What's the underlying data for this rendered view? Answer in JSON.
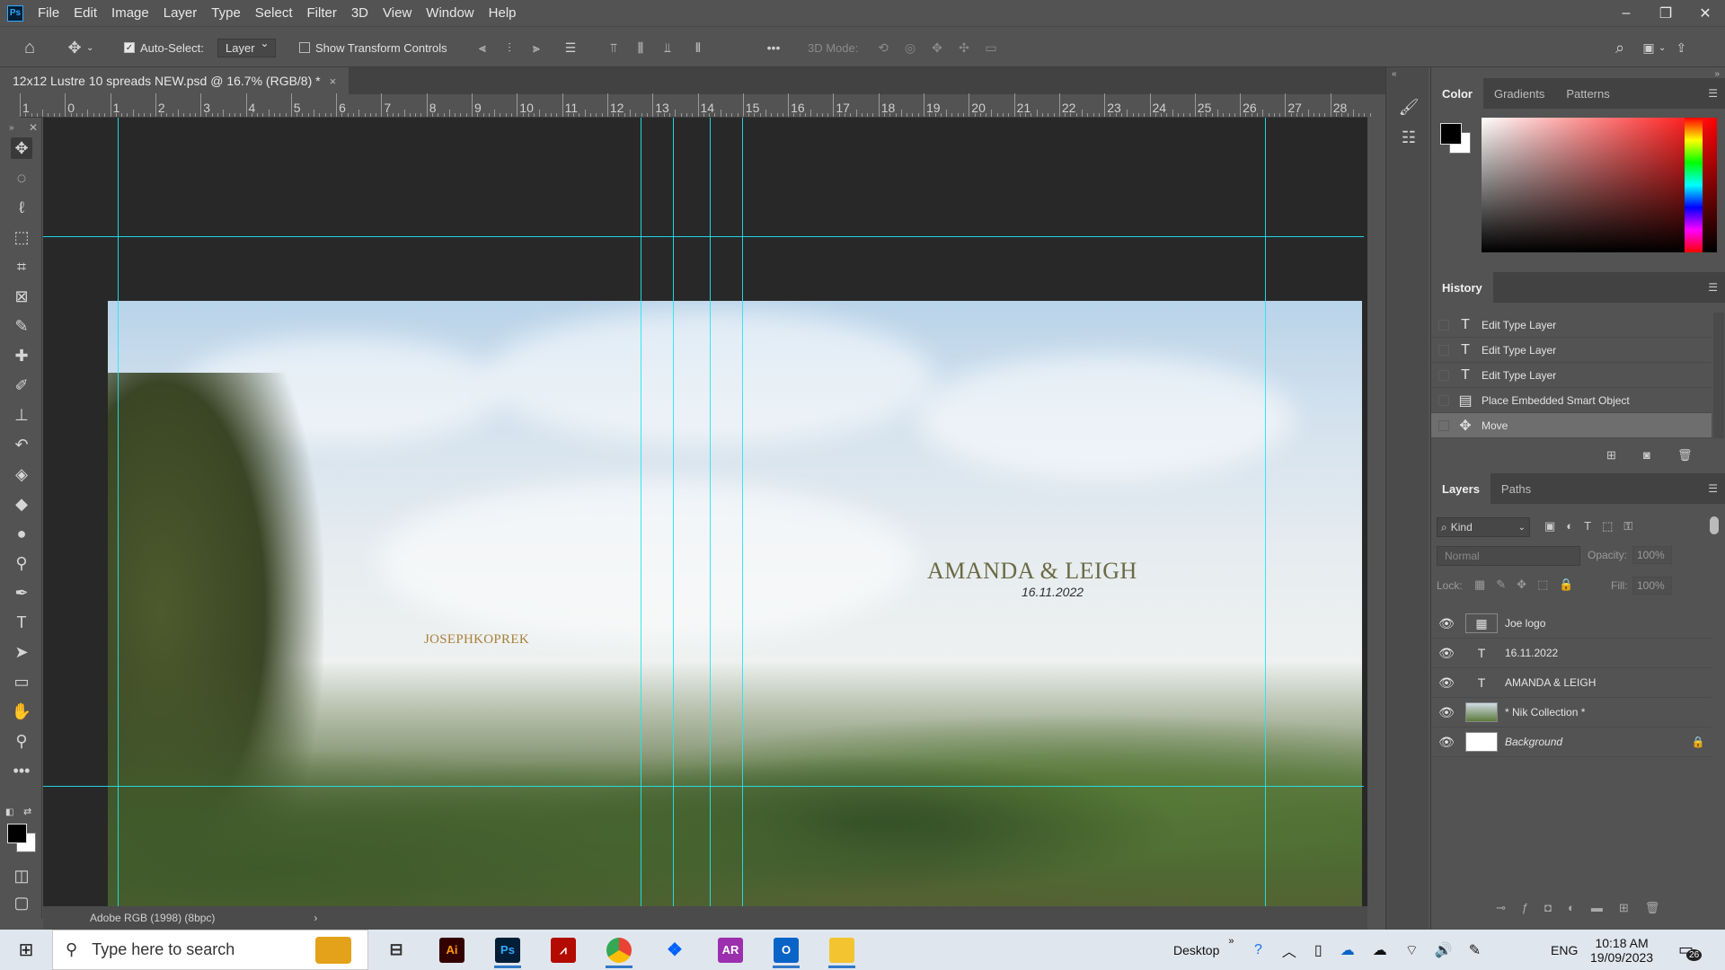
{
  "app": {
    "logo": "Ps",
    "menu": [
      "File",
      "Edit",
      "Image",
      "Layer",
      "Type",
      "Select",
      "Filter",
      "3D",
      "View",
      "Window",
      "Help"
    ],
    "window_controls": [
      "–",
      "❐",
      "✕"
    ]
  },
  "options_bar": {
    "auto_select_label": "Auto-Select:",
    "auto_select_checked": true,
    "auto_select_target": "Layer",
    "show_transform_label": "Show Transform Controls",
    "mode_3d_label": "3D Mode:",
    "more": "•••"
  },
  "document": {
    "tab_title": "12x12 Lustre 10 spreads NEW.psd @ 16.7% (RGB/8) *",
    "close": "×",
    "status": "Adobe RGB (1998) (8bpc)",
    "status_arrow": "›"
  },
  "ruler": {
    "labels": [
      "1",
      "0",
      "1",
      "2",
      "3",
      "4",
      "5",
      "6",
      "7",
      "8",
      "9",
      "10",
      "11",
      "12",
      "13",
      "14",
      "15",
      "16",
      "17",
      "18",
      "19",
      "20",
      "21",
      "22",
      "23",
      "24",
      "25",
      "26",
      "27",
      "28"
    ]
  },
  "artwork": {
    "names": "AMANDA & LEIGH",
    "date": "16.11.2022",
    "logo": "JOSEPHKOPREK"
  },
  "panels": {
    "color_tabs": [
      "Color",
      "Gradients",
      "Patterns"
    ],
    "history_title": "History",
    "history": [
      {
        "label": "Edit Type Layer",
        "icon": "T"
      },
      {
        "label": "Edit Type Layer",
        "icon": "T"
      },
      {
        "label": "Edit Type Layer",
        "icon": "T"
      },
      {
        "label": "Place Embedded Smart Object",
        "icon": "▤"
      },
      {
        "label": "Move",
        "icon": "✥"
      }
    ],
    "layers_tabs": [
      "Layers",
      "Paths"
    ],
    "filter_kind": "Kind",
    "blend_mode": "Normal",
    "opacity_label": "Opacity:",
    "opacity_value": "100%",
    "lock_label": "Lock:",
    "fill_label": "Fill:",
    "fill_value": "100%",
    "layers": [
      {
        "name": "Joe logo",
        "type": "smart"
      },
      {
        "name": "16.11.2022",
        "type": "text"
      },
      {
        "name": "AMANDA & LEIGH",
        "type": "text"
      },
      {
        "name": "* Nik Collection *",
        "type": "image"
      },
      {
        "name": "Background",
        "type": "background",
        "locked": true
      }
    ]
  },
  "taskbar": {
    "search_placeholder": "Type here to search",
    "apps": [
      "Files",
      "Task View",
      "Ai",
      "Ps",
      "Acrobat",
      "Chrome",
      "Dropbox",
      "AR",
      "Outlook",
      "Explorer"
    ],
    "desktop_label": "Desktop",
    "chevron": "»",
    "lang": "ENG",
    "time": "10:18 AM",
    "date": "19/09/2023",
    "notifications": "26"
  },
  "colors": {
    "guide": "#22e5f2",
    "accent": "#31a8ff",
    "panel_bg": "#535353"
  }
}
